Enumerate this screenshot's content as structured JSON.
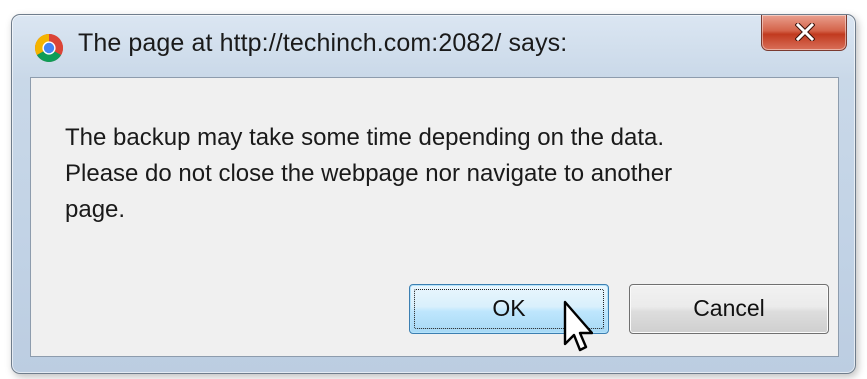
{
  "dialog": {
    "title": "The page at http://techinch.com:2082/ says:",
    "title_icon": "chrome-icon",
    "close_icon": "close-icon",
    "message_lines": [
      "The backup may take some time depending on the data.",
      "Please do not close the webpage nor navigate to another",
      "page."
    ],
    "ok_label": "OK",
    "cancel_label": "Cancel"
  },
  "cursor": {
    "icon": "mouse-pointer-icon"
  },
  "colors": {
    "window_frame": "#c2d3e6",
    "close_button": "#c13a1f",
    "ok_button_border": "#3c7fb1",
    "content_background": "#f0f0f0"
  }
}
